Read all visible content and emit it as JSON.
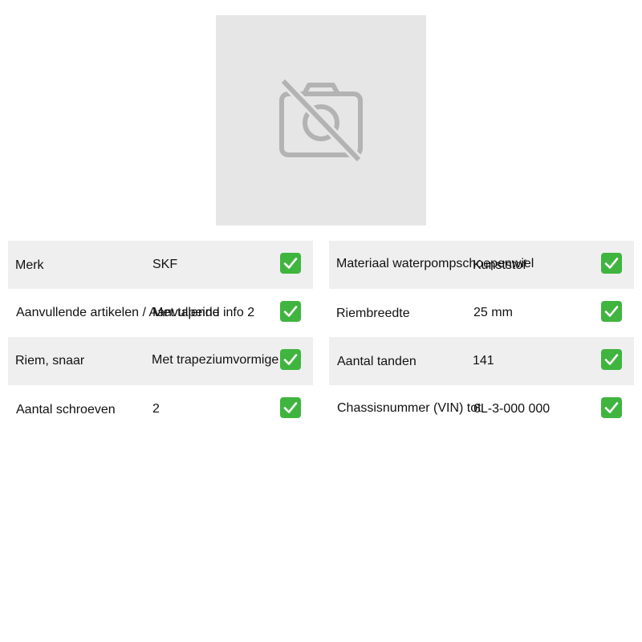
{
  "image": {
    "icon": "camera-off-icon"
  },
  "specs": {
    "left": [
      {
        "label": "Merk",
        "value": "SKF",
        "check_icon": "checkmark-icon"
      },
      {
        "label": "Aanvullende artikelen / Aanvullende info 2",
        "value": "Met tapeind",
        "check_icon": "checkmark-icon"
      },
      {
        "label": "Riem, snaar",
        "value": "Met trapeziumvormige",
        "check_icon": "checkmark-icon"
      },
      {
        "label": "Aantal schroeven",
        "value": "2",
        "check_icon": "checkmark-icon"
      }
    ],
    "right": [
      {
        "label": "Materiaal waterpompschoepenwiel",
        "value": "Kunststof",
        "check_icon": "checkmark-icon"
      },
      {
        "label": "Riembreedte",
        "value": "25 mm",
        "check_icon": "checkmark-icon"
      },
      {
        "label": "Aantal tanden",
        "value": "141",
        "check_icon": "checkmark-icon"
      },
      {
        "label": "Chassisnummer (VIN) tot",
        "value": "6L-3-000 000",
        "check_icon": "checkmark-icon"
      }
    ]
  },
  "colors": {
    "row_shade": "#efefef",
    "placeholder_bg": "#e6e6e6",
    "placeholder_icon": "#b3b3b3",
    "check_bg": "#3fb53f"
  }
}
